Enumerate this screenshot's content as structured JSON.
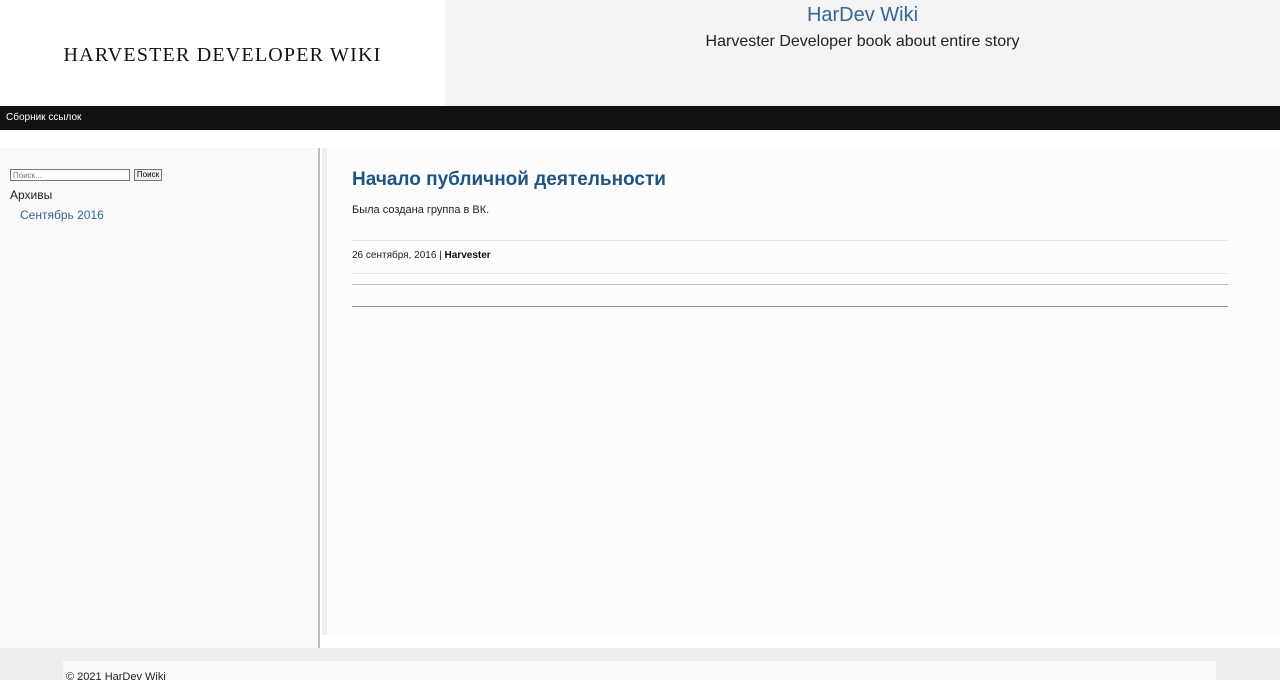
{
  "header": {
    "logo_text": "HARVESTER DEVELOPER WIKI",
    "site_title": "HarDev Wiki",
    "site_description": "Harvester Developer book about entire story"
  },
  "nav": {
    "items": [
      {
        "label": "Сборник ссылок"
      }
    ]
  },
  "sidebar": {
    "search": {
      "placeholder": "Поиск...",
      "value": "",
      "button_label": "Поиск"
    },
    "archives": {
      "title": "Архивы",
      "items": [
        {
          "label": "Сентябрь 2016"
        }
      ]
    }
  },
  "post": {
    "title": "Начало публичной деятельности",
    "text": "Была создана группа в ВК.",
    "date": "26 сентября, 2016",
    "separator": " | ",
    "author": "Harvester"
  },
  "footer": {
    "text": "© 2021 HarDev Wiki"
  }
}
